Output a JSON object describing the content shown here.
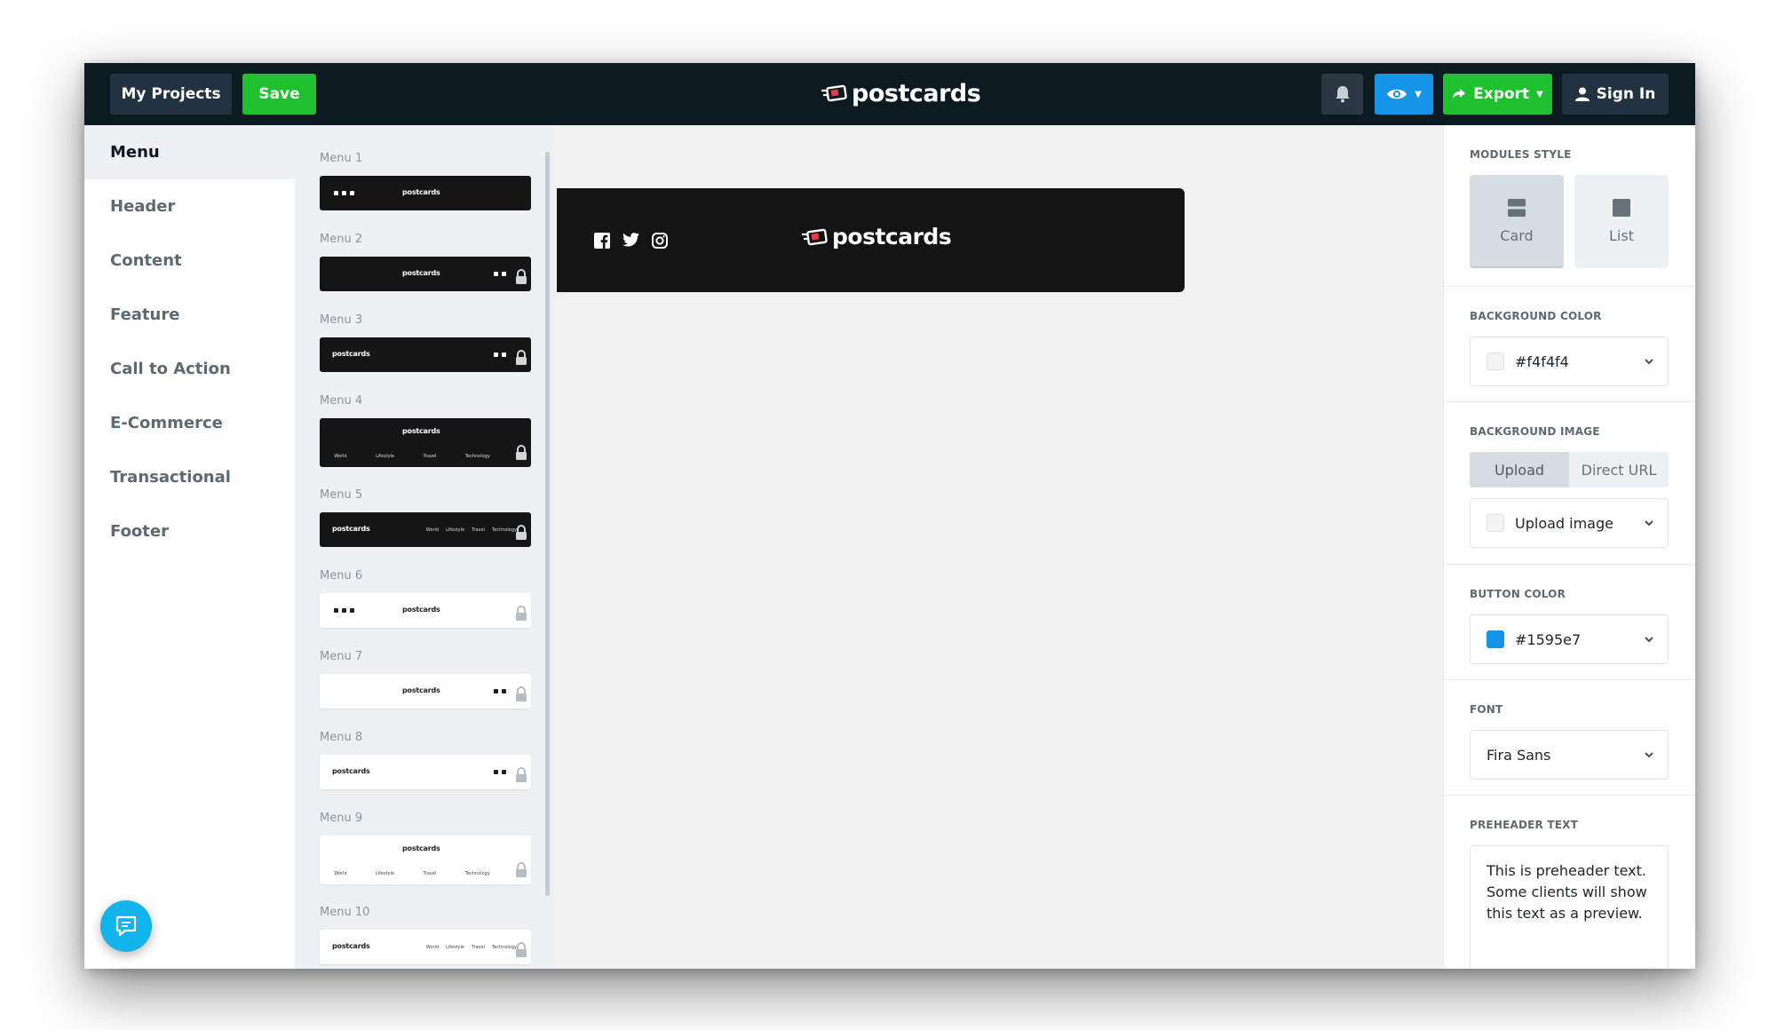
{
  "topbar": {
    "my_projects": "My Projects",
    "save": "Save",
    "logo": "postcards",
    "export": "Export",
    "sign_in": "Sign In",
    "bell_icon": "bell-icon",
    "preview_icon": "eye-icon"
  },
  "categories": [
    "Menu",
    "Header",
    "Content",
    "Feature",
    "Call to Action",
    "E-Commerce",
    "Transactional",
    "Footer"
  ],
  "templates": [
    "Menu 1",
    "Menu 2",
    "Menu 3",
    "Menu 4",
    "Menu 5",
    "Menu 6",
    "Menu 7",
    "Menu 8",
    "Menu 9",
    "Menu 10"
  ],
  "thumb_logo": "postcards",
  "thumb_nav": [
    "World",
    "Lifestyle",
    "Travel",
    "Technology"
  ],
  "canvas": {
    "logo": "postcards",
    "social_icons": [
      "facebook-icon",
      "twitter-icon",
      "instagram-icon"
    ]
  },
  "settings": {
    "modules_style": {
      "title": "MODULES STYLE",
      "card": "Card",
      "list": "List",
      "selected": "Card"
    },
    "background_color": {
      "title": "BACKGROUND COLOR",
      "value": "#f4f4f4"
    },
    "background_image": {
      "title": "BACKGROUND IMAGE",
      "upload_tab": "Upload",
      "direct_url_tab": "Direct URL",
      "value": "Upload image"
    },
    "button_color": {
      "title": "BUTTON COLOR",
      "value": "#1595e7"
    },
    "font": {
      "title": "FONT",
      "value": "Fira Sans"
    },
    "preheader": {
      "title": "PREHEADER TEXT",
      "value": "This is preheader text. Some clients will show this text as a preview."
    }
  },
  "colors": {
    "topbar": "#0c1a22",
    "green": "#1fc22e",
    "blue": "#1595e7",
    "chat": "#13b3ec"
  }
}
